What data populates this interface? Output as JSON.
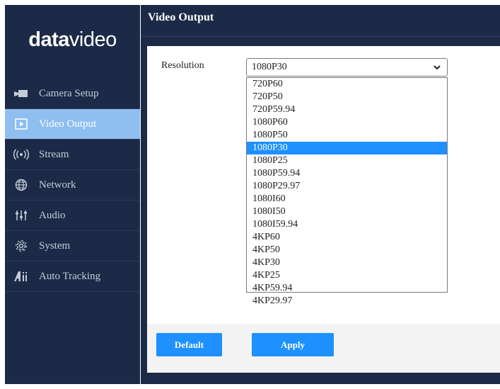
{
  "brand": {
    "logo_text_bold": "data",
    "logo_text_thin": "video"
  },
  "sidebar": {
    "items": [
      {
        "label": "Camera Setup",
        "icon": "camera-icon",
        "active": false
      },
      {
        "label": "Video Output",
        "icon": "video-play-icon",
        "active": true
      },
      {
        "label": "Stream",
        "icon": "broadcast-icon",
        "active": false
      },
      {
        "label": "Network",
        "icon": "globe-icon",
        "active": false
      },
      {
        "label": "Audio",
        "icon": "audio-mixer-icon",
        "active": false
      },
      {
        "label": "System",
        "icon": "gear-icon",
        "active": false
      },
      {
        "label": "Auto Tracking",
        "icon": "auto-tracking-icon",
        "active": false
      }
    ]
  },
  "main": {
    "title": "Video Output",
    "resolution": {
      "label": "Resolution",
      "selected": "1080P30",
      "options": [
        "720P60",
        "720P50",
        "720P59.94",
        "1080P60",
        "1080P50",
        "1080P30",
        "1080P25",
        "1080P59.94",
        "1080P29.97",
        "1080I60",
        "1080I50",
        "1080I59.94",
        "4KP60",
        "4KP50",
        "4KP30",
        "4KP25",
        "4KP59.94",
        "4KP29.97"
      ]
    },
    "buttons": {
      "default_label": "Default",
      "apply_label": "Apply"
    }
  },
  "colors": {
    "sidebar_bg": "#1c2a47",
    "active_item": "#8fbef0",
    "accent": "#1e90ff"
  }
}
